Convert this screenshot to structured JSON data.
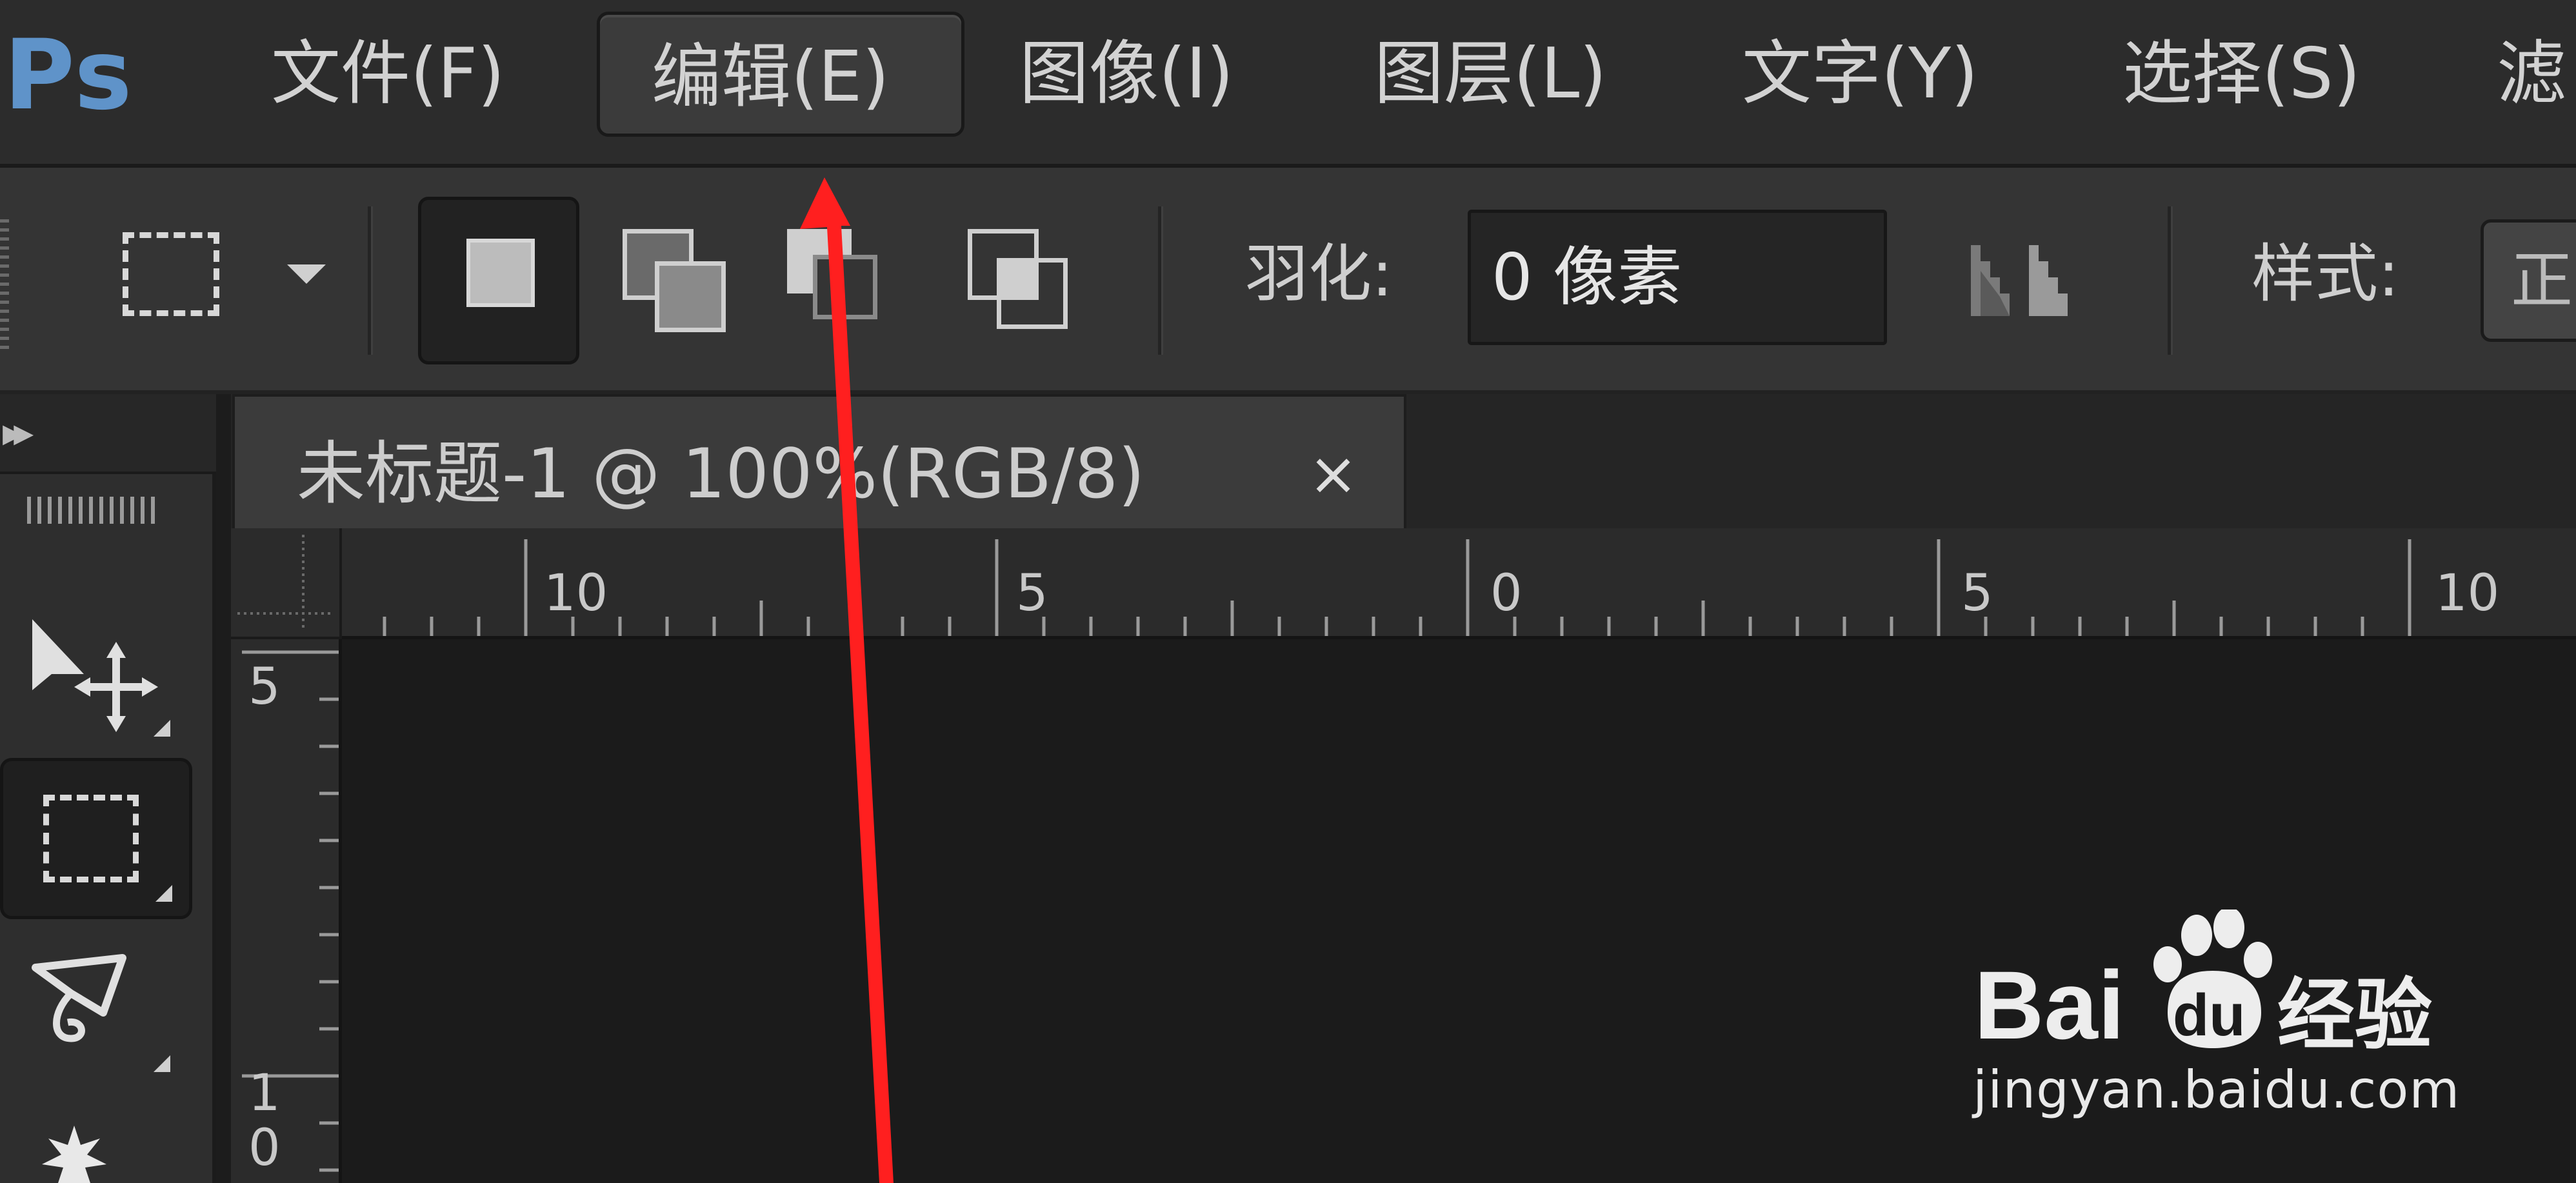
{
  "app": {
    "logo": "Ps"
  },
  "menu": {
    "items": [
      {
        "label": "文件(F)"
      },
      {
        "label": "编辑(E)"
      },
      {
        "label": "图像(I)"
      },
      {
        "label": "图层(L)"
      },
      {
        "label": "文字(Y)"
      },
      {
        "label": "选择(S)"
      },
      {
        "label": "滤"
      }
    ],
    "active_index": 1
  },
  "options": {
    "tool_icon": "rectangular-marquee-icon",
    "selection_modes": [
      "new-selection-icon",
      "add-to-selection-icon",
      "subtract-from-selection-icon",
      "intersect-selection-icon"
    ],
    "selected_mode_index": 0,
    "feather_label": "羽化:",
    "feather_value": "0 像素",
    "antialias_icon": "anti-alias-icon",
    "style_label": "样式:",
    "style_value": "正"
  },
  "tools": [
    {
      "icon": "move-tool-icon"
    },
    {
      "icon": "rectangular-marquee-icon",
      "selected": true
    },
    {
      "icon": "lasso-tool-icon"
    },
    {
      "icon": "quick-selection-icon"
    }
  ],
  "document": {
    "tab_title": "未标题-1 @ 100%(RGB/8)",
    "close_glyph": "×"
  },
  "rulers": {
    "horizontal_labels": [
      "10",
      "5",
      "0",
      "5",
      "10"
    ],
    "vertical_labels": [
      "5",
      "1",
      "0"
    ]
  },
  "annotation": {
    "arrow_color": "#ff1f1f"
  },
  "watermark": {
    "brand": "Bai du 经验",
    "url": "jingyan.baidu.com"
  },
  "colors": {
    "ps_blue": "#5f93c9",
    "ui_dark": "#2c2c2c",
    "canvas": "#1b1b1b"
  }
}
